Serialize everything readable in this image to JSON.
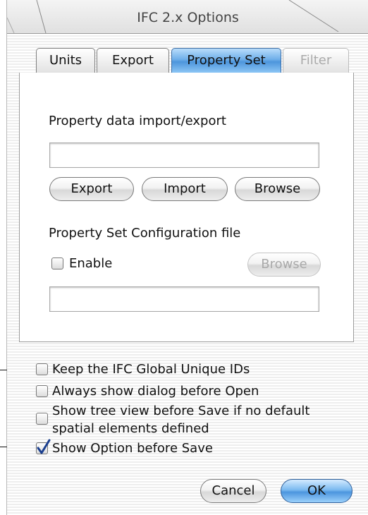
{
  "window": {
    "title": "IFC 2.x Options"
  },
  "tabs": [
    {
      "label": "Units",
      "state": "normal"
    },
    {
      "label": "Export",
      "state": "normal"
    },
    {
      "label": "Property Set",
      "state": "selected"
    },
    {
      "label": "Filter",
      "state": "disabled"
    }
  ],
  "property_data": {
    "heading": "Property data import/export",
    "path_value": "",
    "export_label": "Export",
    "import_label": "Import",
    "browse_label": "Browse"
  },
  "config": {
    "heading": "Property Set Configuration file",
    "enable_label": "Enable",
    "enable_checked": false,
    "browse_label": "Browse",
    "path_value": ""
  },
  "options": [
    {
      "label": "Keep the IFC Global Unique IDs",
      "checked": false
    },
    {
      "label": "Always show dialog before Open",
      "checked": false
    },
    {
      "label_line1": "Show tree view before Save if no default",
      "label_line2": "spatial elements defined",
      "checked": false
    },
    {
      "label": "Show Option before Save",
      "checked": true
    }
  ],
  "footer": {
    "cancel_label": "Cancel",
    "ok_label": "OK"
  },
  "colors": {
    "accent": "#4d95dc",
    "check": "#1b3f8f"
  }
}
